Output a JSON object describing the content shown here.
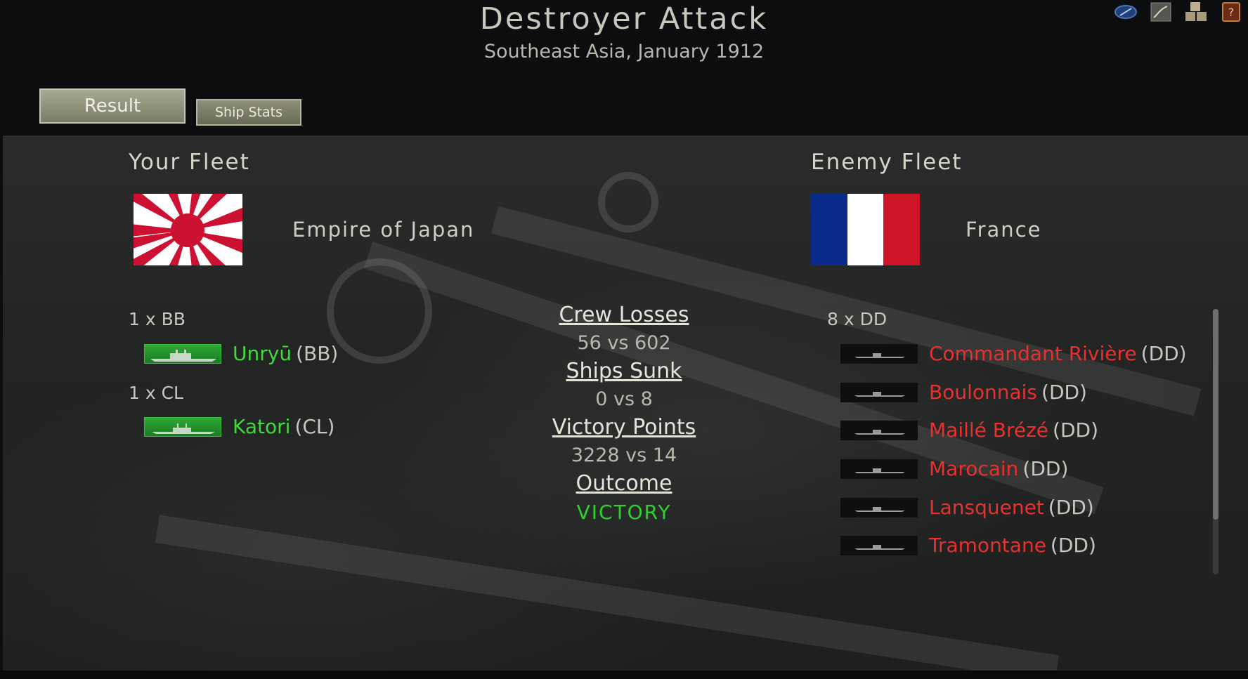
{
  "header": {
    "title": "Destroyer Attack",
    "subtitle": "Southeast Asia, January 1912",
    "icons": [
      "compass-icon",
      "chart-icon",
      "abc-blocks-icon",
      "help-book-icon"
    ]
  },
  "tabs": {
    "result": "Result",
    "ship_stats": "Ship Stats",
    "active": "result"
  },
  "your_fleet": {
    "heading": "Your Fleet",
    "nation": "Empire of Japan",
    "flag": "rising-sun-flag",
    "groups": [
      {
        "label": "1 x BB",
        "ships": [
          {
            "name": "Unryū",
            "type": "(BB)"
          }
        ]
      },
      {
        "label": "1 x CL",
        "ships": [
          {
            "name": "Katori",
            "type": "(CL)"
          }
        ]
      }
    ]
  },
  "enemy_fleet": {
    "heading": "Enemy Fleet",
    "nation": "France",
    "flag": "french-tricolor-flag",
    "groups": [
      {
        "label": "8 x DD",
        "ships": [
          {
            "name": "Commandant Rivière",
            "type": "(DD)"
          },
          {
            "name": "Boulonnais",
            "type": "(DD)"
          },
          {
            "name": "Maillé Brézé",
            "type": "(DD)"
          },
          {
            "name": "Marocain",
            "type": "(DD)"
          },
          {
            "name": "Lansquenet",
            "type": "(DD)"
          },
          {
            "name": "Tramontane",
            "type": "(DD)"
          }
        ]
      }
    ]
  },
  "stats": {
    "crew_losses": {
      "label": "Crew Losses",
      "value": "56 vs 602"
    },
    "ships_sunk": {
      "label": "Ships Sunk",
      "value": "0 vs 8"
    },
    "victory_points": {
      "label": "Victory Points",
      "value": "3228 vs 14"
    },
    "outcome": {
      "label": "Outcome",
      "value": "VICTORY"
    }
  },
  "colors": {
    "own_ship": "#41d93e",
    "enemy_ship": "#e8302e",
    "victory": "#2fd12e",
    "japan_red": "#cc1133",
    "france_blue": "#0a2a8a",
    "france_red": "#d01427"
  }
}
